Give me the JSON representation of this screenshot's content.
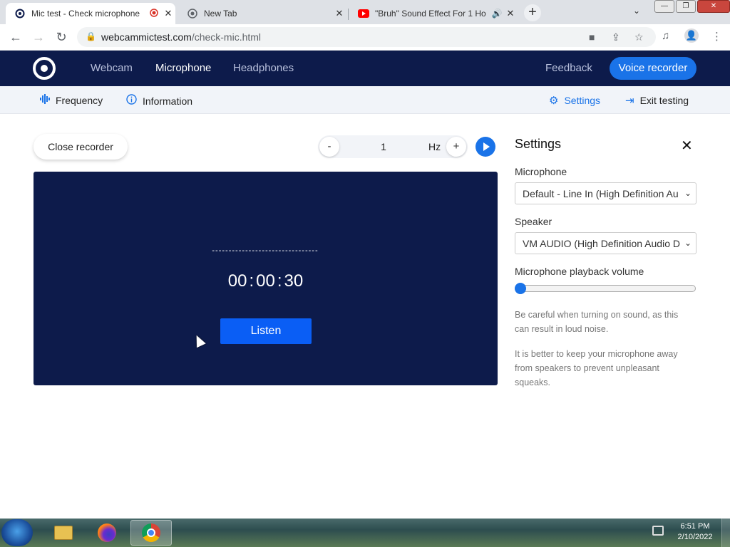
{
  "browser": {
    "tabs": [
      {
        "title": "Mic test - Check microphone"
      },
      {
        "title": "New Tab"
      },
      {
        "title": "\"Bruh\" Sound Effect For 1 Ho"
      }
    ],
    "url_domain": "webcammictest.com",
    "url_path": "/check-mic.html"
  },
  "header": {
    "nav": [
      "Webcam",
      "Microphone",
      "Headphones"
    ],
    "feedback": "Feedback",
    "voice_recorder": "Voice recorder"
  },
  "subnav": {
    "frequency": "Frequency",
    "information": "Information",
    "settings": "Settings",
    "exit": "Exit testing"
  },
  "recorder": {
    "close_label": "Close recorder",
    "minus": "-",
    "plus": "+",
    "hz_value": "1",
    "hz_unit": "Hz",
    "dashes": "--------------------------------",
    "timer": {
      "h": "00",
      "m": "00",
      "s": "30",
      "sep": ":"
    },
    "listen": "Listen"
  },
  "settings": {
    "title": "Settings",
    "close": "✕",
    "microphone_label": "Microphone",
    "microphone_value": "Default - Line In (High Definition Au",
    "speaker_label": "Speaker",
    "speaker_value": "VM AUDIO (High Definition Audio D",
    "volume_label": "Microphone playback volume",
    "volume_level": 0,
    "note1": "Be careful when turning on sound, as this can result in loud noise.",
    "note2": "It is better to keep your microphone away from speakers to prevent unpleasant squeaks."
  },
  "taskbar": {
    "time": "6:51 PM",
    "date": "2/10/2022"
  },
  "colors": {
    "header_bg": "#0d1b4b",
    "accent": "#1a73e8",
    "listen_btn": "#0a5ef5"
  }
}
